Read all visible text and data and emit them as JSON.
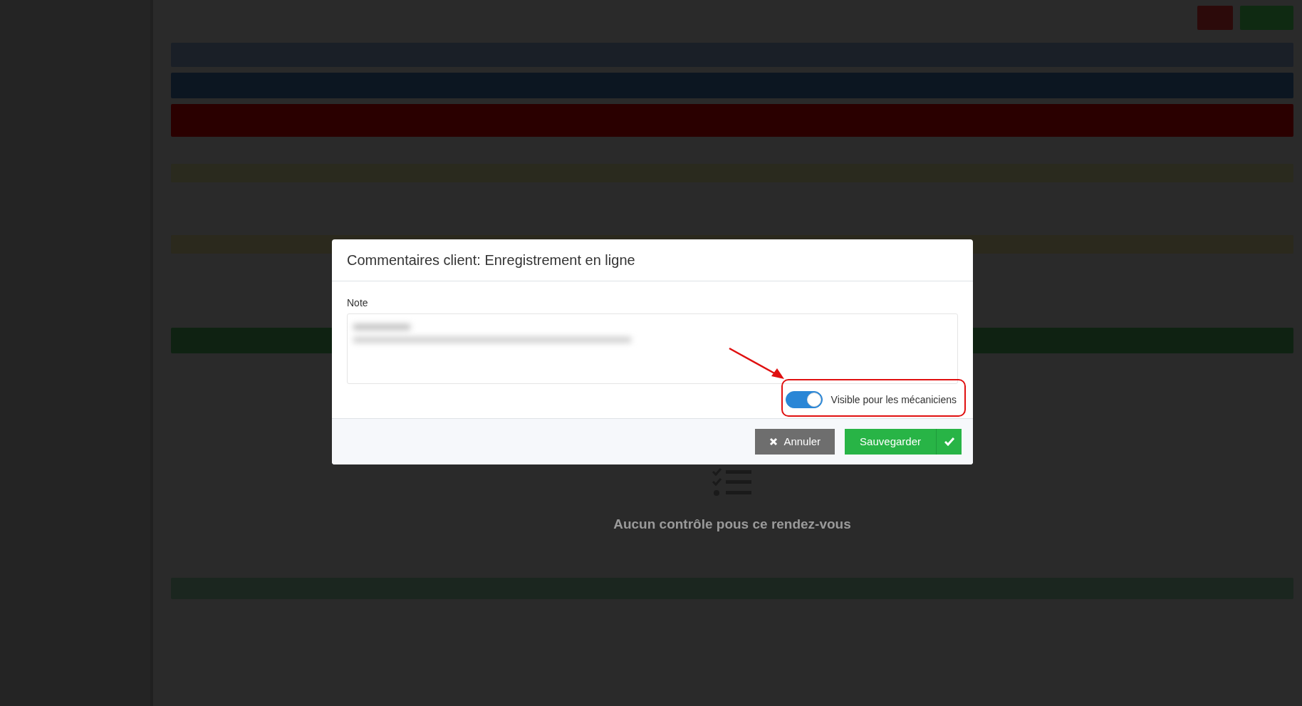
{
  "background": {
    "empty_message": "Aucun contrôle pous ce rendez-vous"
  },
  "modal": {
    "title": "Commentaires client: Enregistrement en ligne",
    "note": {
      "label": "Note"
    },
    "toggle": {
      "label": "Visible pour les mécaniciens",
      "checked": true
    },
    "buttons": [
      {
        "label": "Annuler",
        "kind": "cancel"
      },
      {
        "label": "Sauvegarder",
        "kind": "save"
      }
    ]
  }
}
